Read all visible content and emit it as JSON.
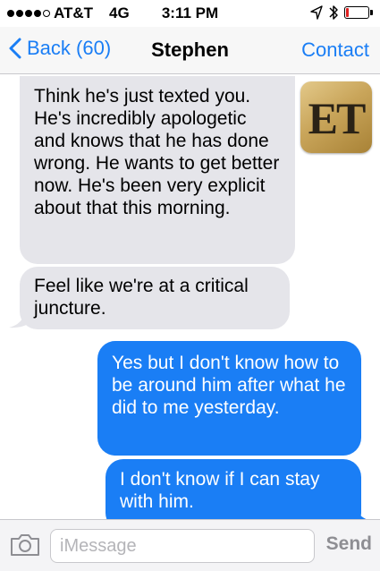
{
  "status_bar": {
    "signal_bars_filled": 4,
    "signal_bars_total": 5,
    "carrier": "AT&T",
    "network": "4G",
    "time": "3:11 PM",
    "icons": [
      "location-arrow-icon",
      "bluetooth-icon",
      "battery-icon"
    ],
    "battery_level": 0.12,
    "battery_color": "#e02020"
  },
  "nav": {
    "back_label": "Back (60)",
    "title": "Stephen",
    "contact_label": "Contact",
    "accent_color": "#1a7ef5"
  },
  "messages": [
    {
      "direction": "incoming",
      "text": "Think he's just texted you. He's incredibly apologetic and knows that he has done wrong. He wants to get better now. He's been very explicit about that this morning."
    },
    {
      "direction": "incoming",
      "text": "Feel like we're at a critical juncture."
    },
    {
      "direction": "outgoing",
      "text": "Yes but I don't know how to be around him after what he did to me yesterday."
    },
    {
      "direction": "outgoing",
      "text": "I don't know if I can stay with him."
    }
  ],
  "overlay_logo": {
    "text": "ET",
    "icon": "et-logo"
  },
  "input_bar": {
    "placeholder": "iMessage",
    "value": "",
    "send_label": "Send",
    "camera_icon": "camera-icon"
  },
  "colors": {
    "incoming_bubble": "#e5e5ea",
    "outgoing_bubble": "#1a7ef5"
  }
}
